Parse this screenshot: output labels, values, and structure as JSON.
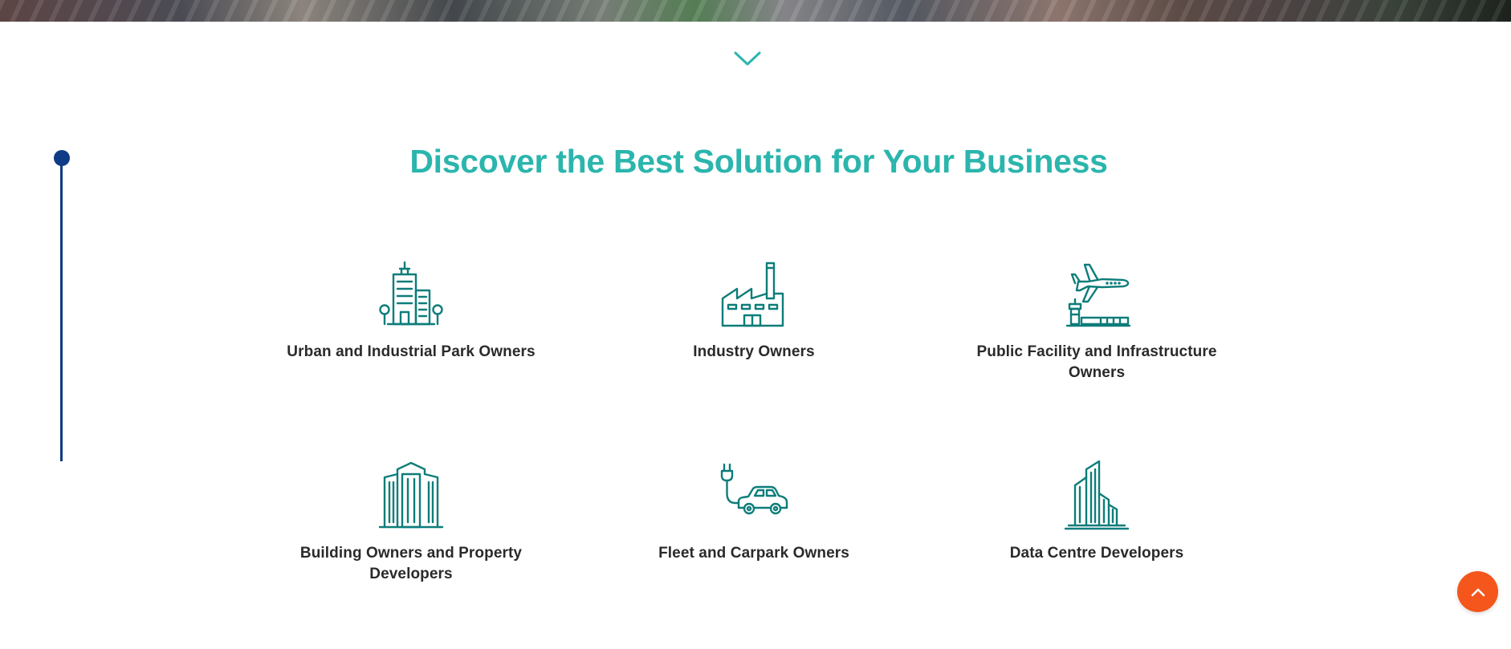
{
  "section": {
    "title": "Discover the Best Solution for Your Business"
  },
  "cards": [
    {
      "label": "Urban and Industrial Park Owners",
      "icon": "city-buildings-icon"
    },
    {
      "label": "Industry Owners",
      "icon": "factory-icon"
    },
    {
      "label": "Public Facility and Infrastructure Owners",
      "icon": "airport-icon"
    },
    {
      "label": "Building Owners and Property Developers",
      "icon": "skyscraper-icon"
    },
    {
      "label": "Fleet and Carpark Owners",
      "icon": "electric-car-icon"
    },
    {
      "label": "Data Centre Developers",
      "icon": "data-centre-building-icon"
    }
  ],
  "colors": {
    "accent": "#2bb5ad",
    "icon": "#0d7d7a",
    "timeline": "#0e3a86",
    "back_to_top": "#f4561b",
    "text": "#2a2a2a"
  },
  "icons": {
    "scroll_down": "chevron-down-icon",
    "back_to_top": "chevron-up-icon"
  }
}
